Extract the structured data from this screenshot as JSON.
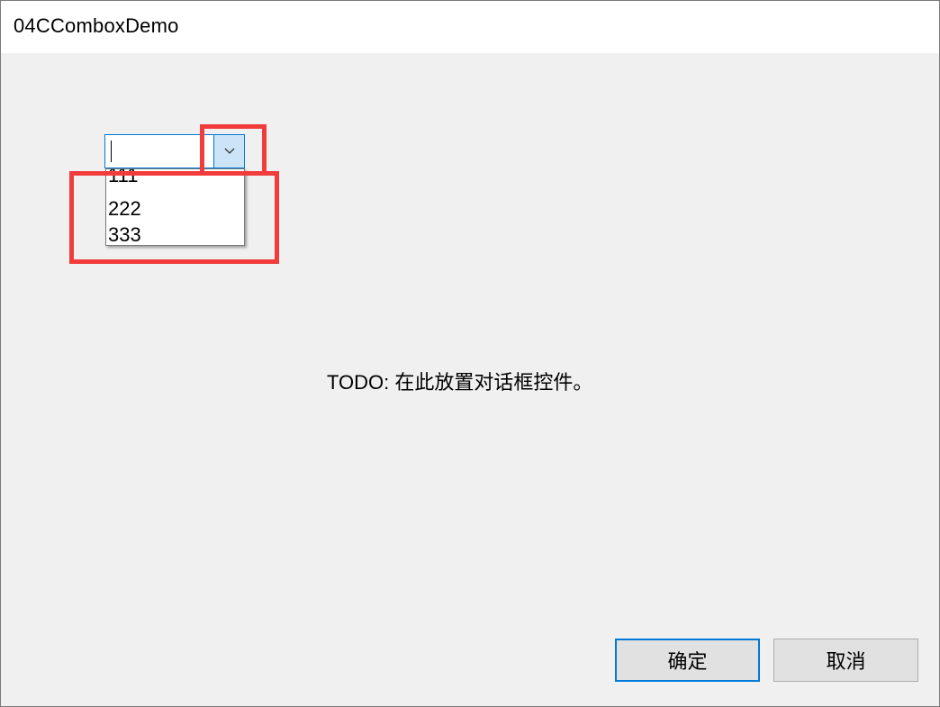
{
  "window": {
    "title": "04CComboxDemo"
  },
  "combo": {
    "current_value": "",
    "dropdown_open": true,
    "items": [
      "111",
      "222",
      "333"
    ]
  },
  "static_text": "TODO: 在此放置对话框控件。",
  "buttons": {
    "ok_label": "确定",
    "cancel_label": "取消"
  },
  "colors": {
    "highlight": "#f23c3c",
    "focus_blue": "#0078d7",
    "dropdown_button_bg": "#cce4f7",
    "dialog_bg": "#f0f0f0"
  },
  "icons": {
    "combo_button": "chevron-down-icon"
  }
}
